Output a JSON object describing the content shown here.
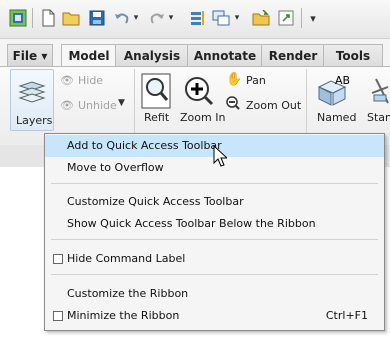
{
  "qat": {
    "icons": [
      "app-icon",
      "new-icon",
      "open-icon",
      "save-icon",
      "undo-icon",
      "undo-dropdown-icon",
      "redo-icon",
      "redo-dropdown-icon",
      "regenerate-icon",
      "windows-icon",
      "windows-dropdown-icon",
      "folder-icon",
      "close-window-icon",
      "customize-qat-icon"
    ]
  },
  "tabs": {
    "file": "File ▾",
    "model": "Model",
    "analysis": "Analysis",
    "annotate": "Annotate",
    "render": "Render",
    "tools": "Tools"
  },
  "ribbon": {
    "layers": "Layers",
    "hide": "Hide",
    "unhide": "Unhide",
    "refit": "Refit",
    "zoom_in": "Zoom In",
    "pan": "Pan",
    "zoom_out": "Zoom Out",
    "named": "Named",
    "standard": "Stan"
  },
  "context_menu": {
    "add_to_qat": "Add to Quick Access Toolbar",
    "move_to_overflow": "Move to Overflow",
    "customize_qat": "Customize Quick Access Toolbar",
    "show_qat_below": "Show Quick Access Toolbar Below the Ribbon",
    "hide_command_label": "Hide Command Label",
    "customize_ribbon": "Customize the Ribbon",
    "minimize_ribbon": "Minimize the Ribbon",
    "minimize_shortcut": "Ctrl+F1"
  },
  "colors": {
    "menu_highlight": "#c7e6fb",
    "ribbon_bg": "#f4f4f4",
    "save_icon": "#2a6db0"
  }
}
